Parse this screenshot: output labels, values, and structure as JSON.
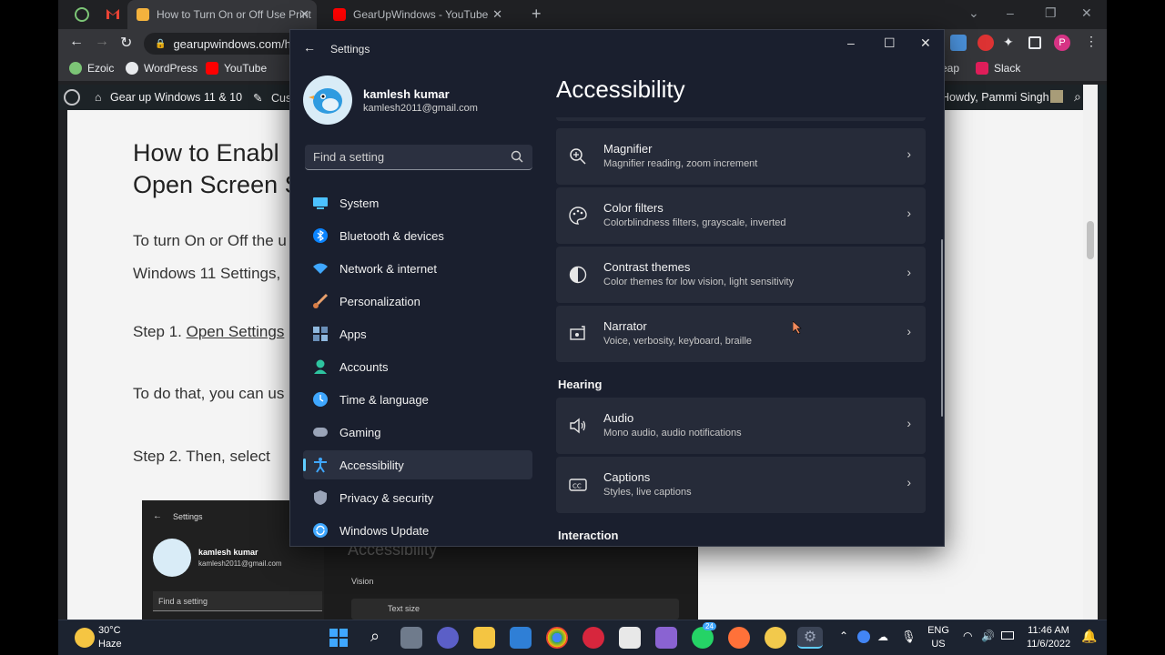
{
  "browser": {
    "tabs": [
      {
        "label": "How to Turn On or Off Use Print"
      },
      {
        "label": "GearUpWindows - YouTube"
      }
    ],
    "url": "gearupwindows.com/h",
    "bookmarks": [
      "Ezoic",
      "WordPress",
      "YouTube",
      "eap",
      "Slack"
    ]
  },
  "wp_admin": {
    "site": "Gear up Windows 11 & 10",
    "customize": "Cust",
    "howdy": "Howdy, Pammi Singh"
  },
  "article": {
    "title_line1": "How to Enabl",
    "title_line2": "Open Screen S",
    "p1": "To turn On or Off the u",
    "p2": "Windows 11 Settings,",
    "step1_prefix": "Step 1.",
    "step1_link": "Open Settings",
    "p3": "To do that, you can us",
    "step2": "Step 2. Then, select"
  },
  "embed": {
    "title": "Settings",
    "user_name": "kamlesh kumar",
    "user_email": "kamlesh2011@gmail.com",
    "search": "Find a setting",
    "heading": "Accessibility",
    "section": "Vision",
    "item": "Text size"
  },
  "settings": {
    "window_title": "Settings",
    "user_name": "kamlesh kumar",
    "user_email": "kamlesh2011@gmail.com",
    "search_placeholder": "Find a setting",
    "page_title": "Accessibility",
    "nav": [
      {
        "label": "System",
        "icon": "system-icon",
        "color": "#4cc2ff"
      },
      {
        "label": "Bluetooth & devices",
        "icon": "bluetooth-icon",
        "color": "#0a84ff"
      },
      {
        "label": "Network & internet",
        "icon": "wifi-icon",
        "color": "#3fa7ff"
      },
      {
        "label": "Personalization",
        "icon": "brush-icon",
        "color": "#e8a06c"
      },
      {
        "label": "Apps",
        "icon": "apps-icon",
        "color": "#8fb8de"
      },
      {
        "label": "Accounts",
        "icon": "accounts-icon",
        "color": "#2ec4a0"
      },
      {
        "label": "Time & language",
        "icon": "clock-globe-icon",
        "color": "#3fa7ff"
      },
      {
        "label": "Gaming",
        "icon": "gamepad-icon",
        "color": "#9aa4b8"
      },
      {
        "label": "Accessibility",
        "icon": "accessibility-icon",
        "color": "#3fa7ff"
      },
      {
        "label": "Privacy & security",
        "icon": "shield-icon",
        "color": "#9aa4b8"
      },
      {
        "label": "Windows Update",
        "icon": "update-icon",
        "color": "#3fa7ff"
      }
    ],
    "cards_vision": [
      {
        "title": "Magnifier",
        "subtitle": "Magnifier reading, zoom increment",
        "icon": "magnifier-icon"
      },
      {
        "title": "Color filters",
        "subtitle": "Colorblindness filters, grayscale, inverted",
        "icon": "palette-icon"
      },
      {
        "title": "Contrast themes",
        "subtitle": "Color themes for low vision, light sensitivity",
        "icon": "contrast-icon"
      },
      {
        "title": "Narrator",
        "subtitle": "Voice, verbosity, keyboard, braille",
        "icon": "narrator-icon"
      }
    ],
    "section_hearing": "Hearing",
    "cards_hearing": [
      {
        "title": "Audio",
        "subtitle": "Mono audio, audio notifications",
        "icon": "speaker-icon"
      },
      {
        "title": "Captions",
        "subtitle": "Styles, live captions",
        "icon": "captions-icon"
      }
    ],
    "section_interaction": "Interaction"
  },
  "taskbar": {
    "weather_temp": "30°C",
    "weather_desc": "Haze",
    "language_line1": "ENG",
    "language_line2": "US",
    "time": "11:46 AM",
    "date": "11/6/2022",
    "whatsapp_badge": "24"
  }
}
